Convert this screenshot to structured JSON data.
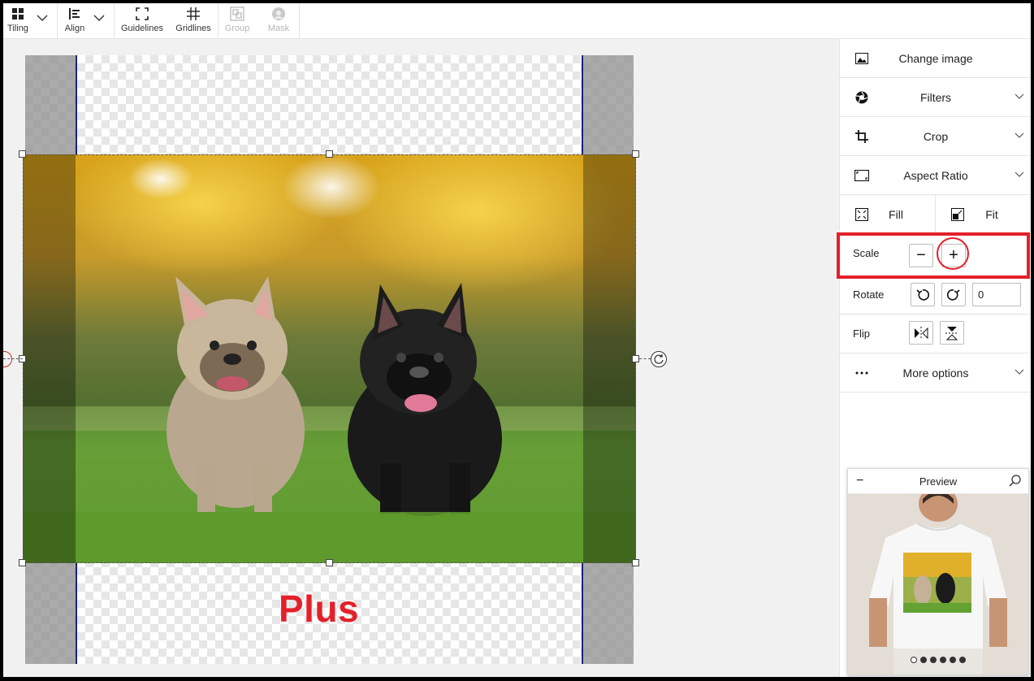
{
  "toolbar": {
    "tiling": "Tiling",
    "align": "Align",
    "guidelines": "Guidelines",
    "gridlines": "Gridlines",
    "group": "Group",
    "mask": "Mask"
  },
  "panel": {
    "change_image": "Change image",
    "filters": "Filters",
    "crop": "Crop",
    "aspect_ratio": "Aspect Ratio",
    "fill": "Fill",
    "fit": "Fit",
    "scale": "Scale",
    "scale_minus": "−",
    "scale_plus": "+",
    "rotate": "Rotate",
    "rotate_value": "0",
    "flip": "Flip",
    "more_options": "More options"
  },
  "preview": {
    "title": "Preview",
    "minimize": "−",
    "dots": 6,
    "active_dot": 0
  },
  "annotation": {
    "text": "Plus",
    "color": "#e3202a"
  },
  "colors": {
    "safe_area_border": "#1a237e",
    "highlight": "#e3202a"
  }
}
